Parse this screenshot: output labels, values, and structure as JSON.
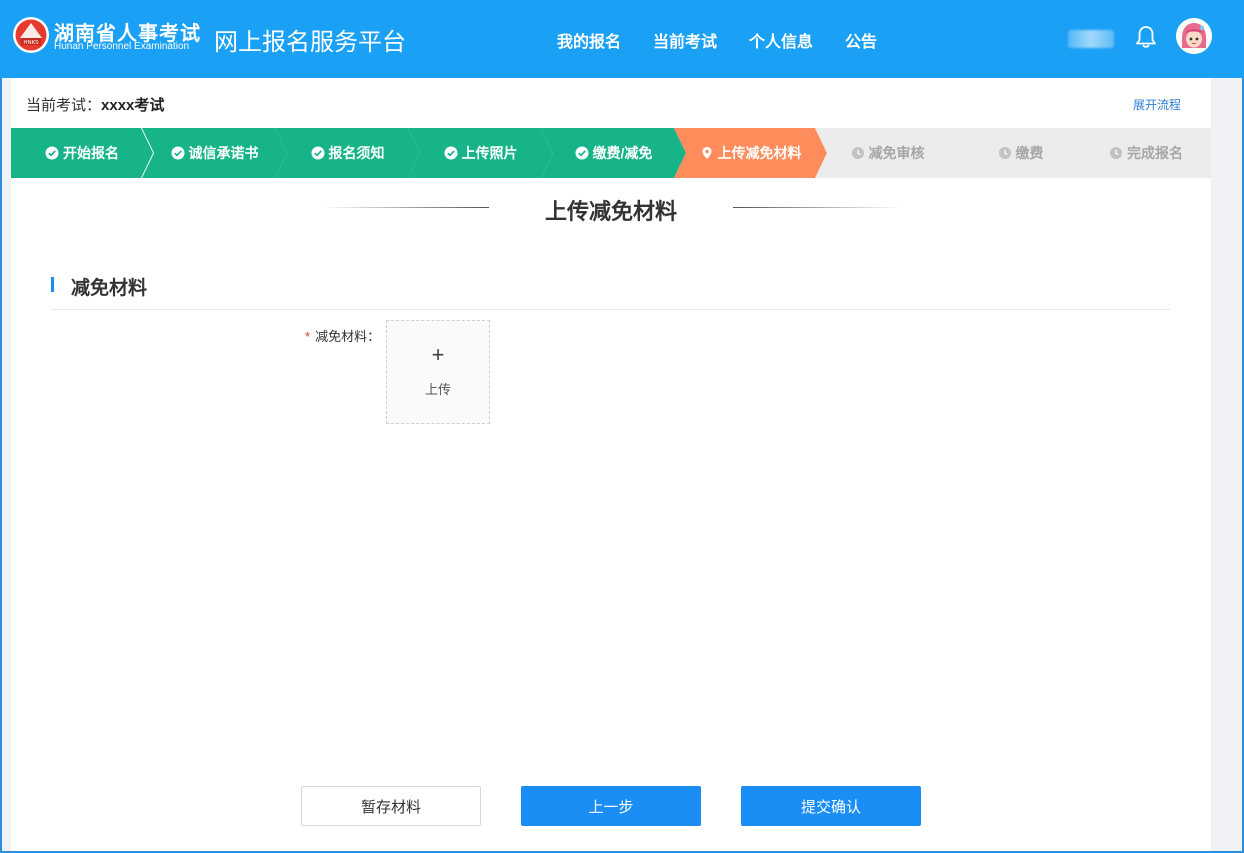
{
  "header": {
    "logo_main": "湖南省人事考试",
    "logo_sub": "Hunan Personnel Examination",
    "logo_badge": "HNKS",
    "platform_title": "网上报名服务平台",
    "nav": [
      {
        "label": "我的报名"
      },
      {
        "label": "当前考试"
      },
      {
        "label": "个人信息"
      },
      {
        "label": "公告"
      }
    ],
    "colors": {
      "brand": "#1aa0f5"
    }
  },
  "exam": {
    "label": "当前考试：",
    "value": "xxxx考试",
    "expand_link": "展开流程"
  },
  "steps": [
    {
      "label": "开始报名",
      "status": "done"
    },
    {
      "label": "诚信承诺书",
      "status": "done"
    },
    {
      "label": "报名须知",
      "status": "done"
    },
    {
      "label": "上传照片",
      "status": "done"
    },
    {
      "label": "缴费/减免",
      "status": "done"
    },
    {
      "label": "上传减免材料",
      "status": "active"
    },
    {
      "label": "减免审核",
      "status": "todo"
    },
    {
      "label": "缴费",
      "status": "todo"
    },
    {
      "label": "完成报名",
      "status": "todo"
    }
  ],
  "step_colors": {
    "done": "#17b48a",
    "active": "#ff8c5a",
    "todo": "#ececec"
  },
  "page_title": "上传减免材料",
  "section": {
    "title": "减免材料",
    "field_required_mark": "*",
    "field_label": "减免材料：",
    "upload_plus": "+",
    "upload_label": "上传"
  },
  "buttons": {
    "save": "暂存材料",
    "prev": "上一步",
    "submit": "提交确认"
  }
}
